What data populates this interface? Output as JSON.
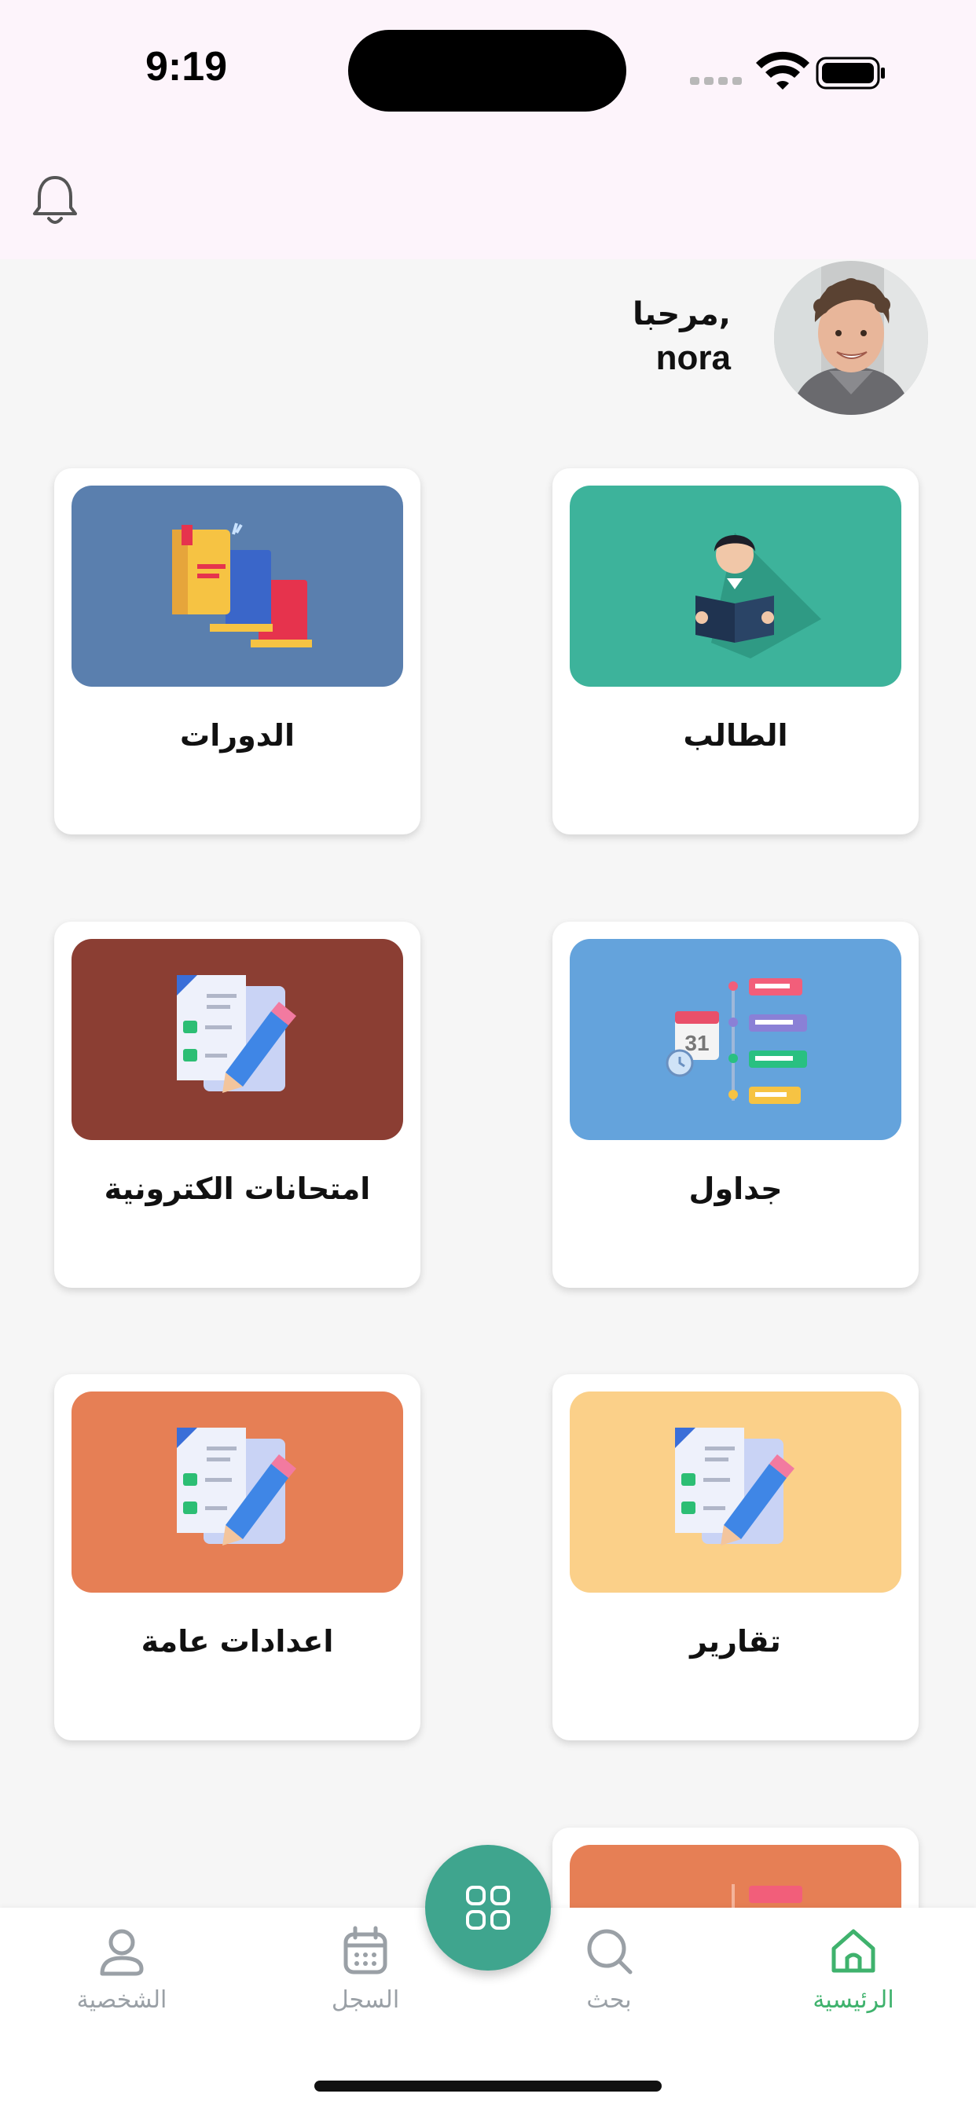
{
  "status_bar": {
    "time": "9:19"
  },
  "header": {
    "greeting": "مرحبا,",
    "user_name": "nora"
  },
  "cards": [
    {
      "label": "الطالب",
      "color": "#3db39b",
      "icon": "student-reading-icon"
    },
    {
      "label": "الدورات",
      "color": "#5a7fae",
      "icon": "books-icon"
    },
    {
      "label": "جداول",
      "color": "#64a3dc",
      "icon": "schedule-calendar-icon"
    },
    {
      "label": "امتحانات الكترونية",
      "color": "#8b3e33",
      "icon": "exam-checklist-icon"
    },
    {
      "label": "تقارير",
      "color": "#fbd089",
      "icon": "reports-checklist-icon"
    },
    {
      "label": "اعدادات عامة",
      "color": "#e67f55",
      "icon": "settings-checklist-icon"
    }
  ],
  "bottom_nav": {
    "items": [
      {
        "label": "الرئيسية",
        "icon": "home-icon",
        "active": true
      },
      {
        "label": "بحث",
        "icon": "search-icon",
        "active": false
      },
      {
        "label": "السجل",
        "icon": "calendar-icon",
        "active": false
      },
      {
        "label": "الشخصية",
        "icon": "profile-icon",
        "active": false
      }
    ],
    "fab_icon": "grid-apps-icon"
  },
  "colors": {
    "accent": "#3fa58e",
    "active_nav": "#3fb26d",
    "header_bg": "#fdf4fb"
  }
}
